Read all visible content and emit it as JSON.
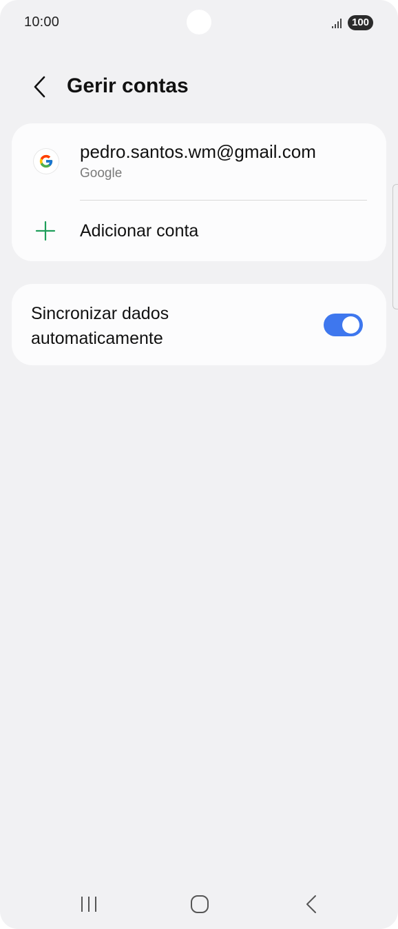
{
  "status_bar": {
    "time": "10:00",
    "battery": "100",
    "signal_icon": "signal-bars-icon"
  },
  "header": {
    "back_icon": "chevron-left-icon",
    "title": "Gerir contas"
  },
  "accounts": [
    {
      "email": "pedro.santos.wm@gmail.com",
      "provider": "Google",
      "icon": "google-logo-icon"
    }
  ],
  "add_account": {
    "label": "Adicionar conta",
    "icon": "plus-icon",
    "icon_color": "#1e9e5a"
  },
  "sync": {
    "label": "Sincronizar dados automaticamente",
    "enabled": true,
    "toggle_color": "#3e77ee"
  },
  "nav_bar": {
    "recents_icon": "recents-icon",
    "home_icon": "home-icon",
    "back_icon": "back-chevron-icon"
  }
}
